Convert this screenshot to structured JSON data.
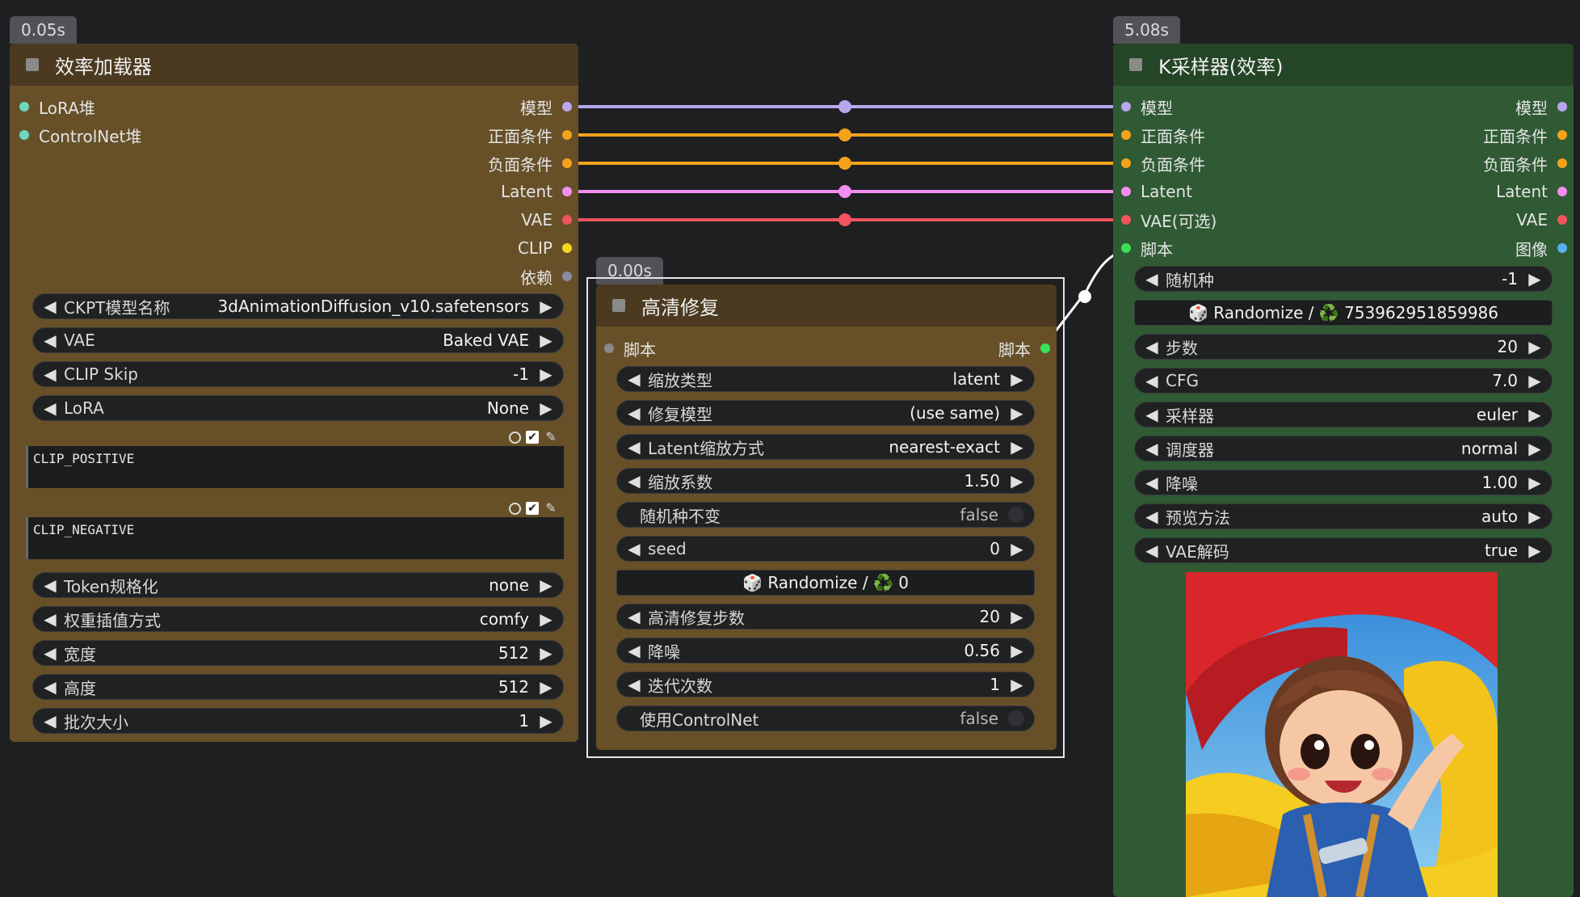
{
  "colors": {
    "canvas_bg": "#1e1f21",
    "loader_body": "#675028",
    "loader_title": "#4b3a20",
    "hires_body": "#675028",
    "ksampler_body": "#2f5a33",
    "ksampler_title": "#244526",
    "link_model": "#b8a6ef",
    "link_positive": "#f5a21b",
    "link_negative": "#f5a21b",
    "link_latent": "#f28ef0",
    "link_vae": "#f0555e",
    "link_script": "#ffffff",
    "slot_lora": "#6dd6c0",
    "slot_model": "#b8a6ef",
    "slot_cond": "#f5a21b",
    "slot_latent": "#f28ef0",
    "slot_vae": "#f0555e",
    "slot_clip": "#f5d81b",
    "slot_depends": "#8a8aa0",
    "slot_script": "#39e05a",
    "slot_image": "#5aaef2"
  },
  "loader": {
    "time": "0.05s",
    "title": "效率加载器",
    "inputs": [
      "LoRA堆",
      "ControlNet堆"
    ],
    "outputs": [
      "模型",
      "正面条件",
      "负面条件",
      "Latent",
      "VAE",
      "CLIP",
      "依赖"
    ],
    "widgets_top": [
      {
        "label": "CKPT模型名称",
        "value": "3dAnimationDiffusion_v10.safetensors"
      },
      {
        "label": "VAE",
        "value": "Baked VAE"
      },
      {
        "label": "CLIP Skip",
        "value": "-1"
      },
      {
        "label": "LoRA",
        "value": "None"
      }
    ],
    "positive_text": "CLIP_POSITIVE",
    "negative_text": "CLIP_NEGATIVE",
    "widgets_bottom": [
      {
        "label": "Token规格化",
        "value": "none"
      },
      {
        "label": "权重插值方式",
        "value": "comfy"
      },
      {
        "label": "宽度",
        "value": "512"
      },
      {
        "label": "高度",
        "value": "512"
      },
      {
        "label": "批次大小",
        "value": "1"
      }
    ]
  },
  "hires": {
    "time": "0.00s",
    "title": "高清修复",
    "input": "脚本",
    "output": "脚本",
    "widgets": [
      {
        "kind": "combo",
        "label": "缩放类型",
        "value": "latent"
      },
      {
        "kind": "combo",
        "label": "修复模型",
        "value": "(use same)"
      },
      {
        "kind": "combo",
        "label": "Latent缩放方式",
        "value": "nearest-exact"
      },
      {
        "kind": "combo",
        "label": "缩放系数",
        "value": "1.50"
      },
      {
        "kind": "toggle",
        "label": "随机种不变",
        "value": "false"
      },
      {
        "kind": "combo",
        "label": "seed",
        "value": "0"
      },
      {
        "kind": "button",
        "label": "",
        "value": "🎲 Randomize / ♻️ 0"
      },
      {
        "kind": "combo",
        "label": "高清修复步数",
        "value": "20"
      },
      {
        "kind": "combo",
        "label": "降噪",
        "value": "0.56"
      },
      {
        "kind": "combo",
        "label": "迭代次数",
        "value": "1"
      },
      {
        "kind": "toggle",
        "label": "使用ControlNet",
        "value": "false"
      }
    ]
  },
  "ksampler": {
    "time": "5.08s",
    "title": "K采样器(效率)",
    "inputs": [
      "模型",
      "正面条件",
      "负面条件",
      "Latent",
      "VAE(可选)",
      "脚本"
    ],
    "outputs": [
      "模型",
      "正面条件",
      "负面条件",
      "Latent",
      "VAE",
      "图像"
    ],
    "widgets": [
      {
        "kind": "combo",
        "label": "随机种",
        "value": "-1"
      },
      {
        "kind": "button",
        "label": "",
        "value": "🎲 Randomize / ♻️ 753962951859986"
      },
      {
        "kind": "combo",
        "label": "步数",
        "value": "20"
      },
      {
        "kind": "combo",
        "label": "CFG",
        "value": "7.0"
      },
      {
        "kind": "combo",
        "label": "采样器",
        "value": "euler"
      },
      {
        "kind": "combo",
        "label": "调度器",
        "value": "normal"
      },
      {
        "kind": "combo",
        "label": "降噪",
        "value": "1.00"
      },
      {
        "kind": "combo",
        "label": "预览方法",
        "value": "auto"
      },
      {
        "kind": "combo",
        "label": "VAE解码",
        "value": "true"
      }
    ]
  }
}
